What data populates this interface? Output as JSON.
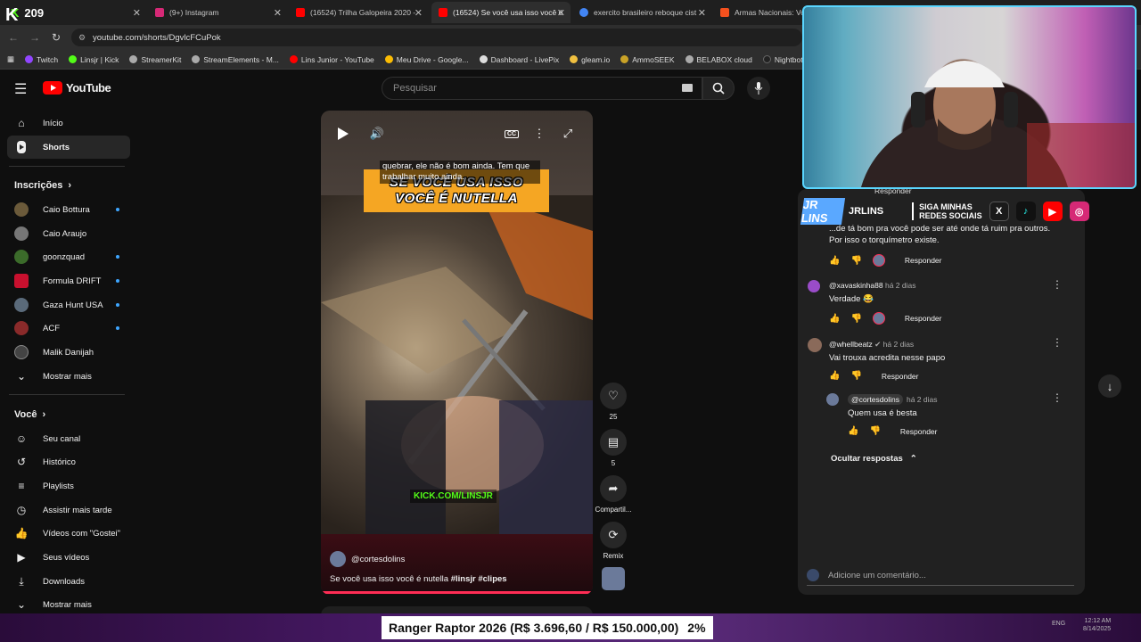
{
  "browser": {
    "counter": "209",
    "tabs": [
      {
        "title": "",
        "favcolor": "#53fc18"
      },
      {
        "title": "(9+) Instagram",
        "favcolor": "#d62976"
      },
      {
        "title": "(16524) Trilha Galopeira 2020 -",
        "favcolor": "#ff0000"
      },
      {
        "title": "(16524) Se você usa isso você é",
        "favcolor": "#ff0000"
      },
      {
        "title": "exercito brasileiro reboque cist",
        "favcolor": "#4285f4"
      },
      {
        "title": "Armas Nacionais: Volk",
        "favcolor": "#f4511e"
      }
    ],
    "url": "youtube.com/shorts/DgvlcFCuPok",
    "bookmarks": [
      "Twitch",
      "Linsjr | Kick",
      "StreamerKit",
      "StreamElements - M...",
      "Lins Junior - YouTube",
      "Meu Drive - Google...",
      "Dashboard - LivePix",
      "gleam.io",
      "AmmoSEEK",
      "BELABOX cloud",
      "Nightbot - Comm"
    ]
  },
  "youtube": {
    "logo": "YouTube",
    "search_placeholder": "Pesquisar"
  },
  "sidebar": {
    "main": [
      {
        "label": "Início",
        "icon": "home-icon"
      },
      {
        "label": "Shorts",
        "icon": "shorts-icon"
      }
    ],
    "subs_heading": "Inscrições",
    "subscriptions": [
      {
        "label": "Caio Bottura",
        "color": "#6b5a3a",
        "dot": true
      },
      {
        "label": "Caio Araujo",
        "color": "#777777",
        "dot": false
      },
      {
        "label": "goonzquad",
        "color": "#3b6b2a",
        "dot": true
      },
      {
        "label": "Formula DRIFT",
        "color": "#c8102e",
        "dot": true
      },
      {
        "label": "Gaza Hunt USA",
        "color": "#5a6a7a",
        "dot": true
      },
      {
        "label": "ACF",
        "color": "#8a2a2a",
        "dot": true
      },
      {
        "label": "Malik Danijah",
        "color": "#444444",
        "dot": false
      }
    ],
    "subs_more": "Mostrar mais",
    "you_heading": "Você",
    "you_items": [
      {
        "label": "Seu canal",
        "icon": "channel-icon"
      },
      {
        "label": "Histórico",
        "icon": "history-icon"
      },
      {
        "label": "Playlists",
        "icon": "playlists-icon"
      },
      {
        "label": "Assistir mais tarde",
        "icon": "watch-later-icon"
      },
      {
        "label": "Vídeos com \"Gostei\"",
        "icon": "like-icon"
      },
      {
        "label": "Seus vídeos",
        "icon": "your-videos-icon"
      },
      {
        "label": "Downloads",
        "icon": "download-icon"
      }
    ],
    "you_more": "Mostrar mais"
  },
  "video": {
    "subtitle": "quebrar, ele não é bom ainda. Tem que trabalhar muito ainda.",
    "banner_line1": "SE VOCÊ USA ISSO",
    "banner_line2": "VOCÊ É NUTELLA",
    "watermark": "KICK.COM/LINSJR",
    "channel": "@cortesdolins",
    "title_prefix": "Se você usa isso você é nutella ",
    "hashtags": "#linsjr #clipes",
    "cc_label": "CC"
  },
  "actions": {
    "likes": "25",
    "comments": "5",
    "share_label": "Compartil...",
    "remix_label": "Remix"
  },
  "comments": {
    "partial_reply": "Responder",
    "partial_text1": "...de tá bom pra você pode ser até onde tá ruim pra outros.",
    "partial_text2": "Por isso o torquímetro existe.",
    "reply_label": "Responder",
    "items": [
      {
        "user": "@xavaskinha88",
        "ago": "há 2 dias",
        "text": "Verdade 😂"
      },
      {
        "user": "@whellbeatz",
        "ago": "há 2 dias",
        "text": "Vai trouxa acredita nesse papo"
      },
      {
        "user": "@cortesdolins",
        "ago": "há 2 dias",
        "text": "Quem usa é besta"
      }
    ],
    "hide_replies": "Ocultar respostas",
    "add_placeholder": "Adicione um comentário..."
  },
  "stream_overlay": {
    "logo": "JR LINS",
    "channel": "JRLINS",
    "social_line1": "SIGA MINHAS",
    "social_line2": "REDES SOCIAIS",
    "ticker_text": "Ranger Raptor 2026 (R$ 3.696,60 / R$ 150.000,00)",
    "ticker_percent": "2%",
    "goal_progress": 0.02,
    "kick_badge": "K",
    "lang": "ENG",
    "time": "12:12 AM",
    "date": "8/14/2025"
  }
}
